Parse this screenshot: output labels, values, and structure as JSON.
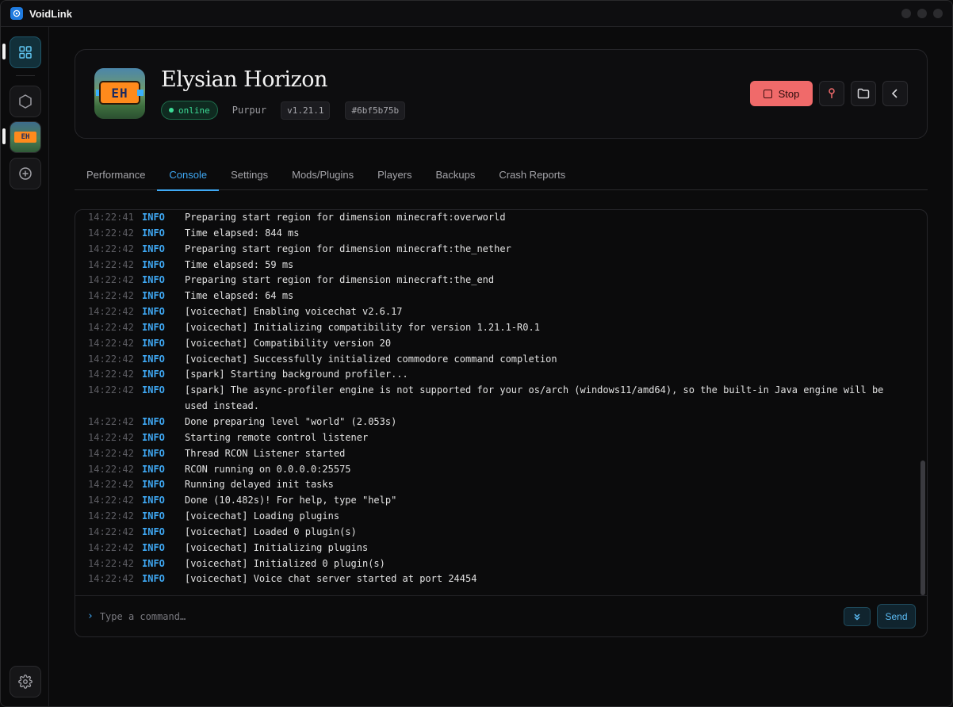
{
  "app": {
    "title": "VoidLink"
  },
  "server": {
    "name": "Elysian Horizon",
    "status": "online",
    "software": "Purpur",
    "version": "v1.21.1",
    "id": "#6bf5b75b",
    "icon_text": "EH"
  },
  "actions": {
    "stop_label": "Stop"
  },
  "tabs": [
    {
      "label": "Performance"
    },
    {
      "label": "Console"
    },
    {
      "label": "Settings"
    },
    {
      "label": "Mods/Plugins"
    },
    {
      "label": "Players"
    },
    {
      "label": "Backups"
    },
    {
      "label": "Crash Reports"
    }
  ],
  "active_tab": "Console",
  "console": {
    "lines": [
      {
        "time": "14:22:41",
        "level": "INFO",
        "msg": "Preparing start region for dimension minecraft:overworld"
      },
      {
        "time": "14:22:42",
        "level": "INFO",
        "msg": "Time elapsed: 844 ms"
      },
      {
        "time": "14:22:42",
        "level": "INFO",
        "msg": "Preparing start region for dimension minecraft:the_nether"
      },
      {
        "time": "14:22:42",
        "level": "INFO",
        "msg": "Time elapsed: 59 ms"
      },
      {
        "time": "14:22:42",
        "level": "INFO",
        "msg": "Preparing start region for dimension minecraft:the_end"
      },
      {
        "time": "14:22:42",
        "level": "INFO",
        "msg": "Time elapsed: 64 ms"
      },
      {
        "time": "14:22:42",
        "level": "INFO",
        "msg": "[voicechat] Enabling voicechat v2.6.17"
      },
      {
        "time": "14:22:42",
        "level": "INFO",
        "msg": "[voicechat] Initializing compatibility for version 1.21.1-R0.1"
      },
      {
        "time": "14:22:42",
        "level": "INFO",
        "msg": "[voicechat] Compatibility version 20"
      },
      {
        "time": "14:22:42",
        "level": "INFO",
        "msg": "[voicechat] Successfully initialized commodore command completion"
      },
      {
        "time": "14:22:42",
        "level": "INFO",
        "msg": "[spark] Starting background profiler..."
      },
      {
        "time": "14:22:42",
        "level": "INFO",
        "msg": "[spark] The async-profiler engine is not supported for your os/arch (windows11/amd64), so the built-in Java engine will be used instead."
      },
      {
        "time": "14:22:42",
        "level": "INFO",
        "msg": "Done preparing level \"world\" (2.053s)"
      },
      {
        "time": "14:22:42",
        "level": "INFO",
        "msg": "Starting remote control listener"
      },
      {
        "time": "14:22:42",
        "level": "INFO",
        "msg": "Thread RCON Listener started"
      },
      {
        "time": "14:22:42",
        "level": "INFO",
        "msg": "RCON running on 0.0.0.0:25575"
      },
      {
        "time": "14:22:42",
        "level": "INFO",
        "msg": "Running delayed init tasks"
      },
      {
        "time": "14:22:42",
        "level": "INFO",
        "msg": "Done (10.482s)! For help, type \"help\""
      },
      {
        "time": "14:22:42",
        "level": "INFO",
        "msg": "[voicechat] Loading plugins"
      },
      {
        "time": "14:22:42",
        "level": "INFO",
        "msg": "[voicechat] Loaded 0 plugin(s)"
      },
      {
        "time": "14:22:42",
        "level": "INFO",
        "msg": "[voicechat] Initializing plugins"
      },
      {
        "time": "14:22:42",
        "level": "INFO",
        "msg": "[voicechat] Initialized 0 plugin(s)"
      },
      {
        "time": "14:22:42",
        "level": "INFO",
        "msg": "[voicechat] Voice chat server started at port 24454"
      }
    ],
    "prompt": "›",
    "placeholder": "Type a command…",
    "send_label": "Send"
  },
  "icons": {
    "app_logo": "app-logo-icon",
    "dashboard": "grid-icon",
    "servers": "hexagon-icon",
    "add": "plus-circle-icon",
    "settings": "gear-icon",
    "map_pin": "map-pin-icon",
    "folder": "folder-icon",
    "back": "chevron-left-icon",
    "scroll_bottom": "chevrons-down-icon"
  },
  "colors": {
    "accent": "#3fa9f5",
    "online": "#3ddc97",
    "stop": "#f06a6a"
  }
}
